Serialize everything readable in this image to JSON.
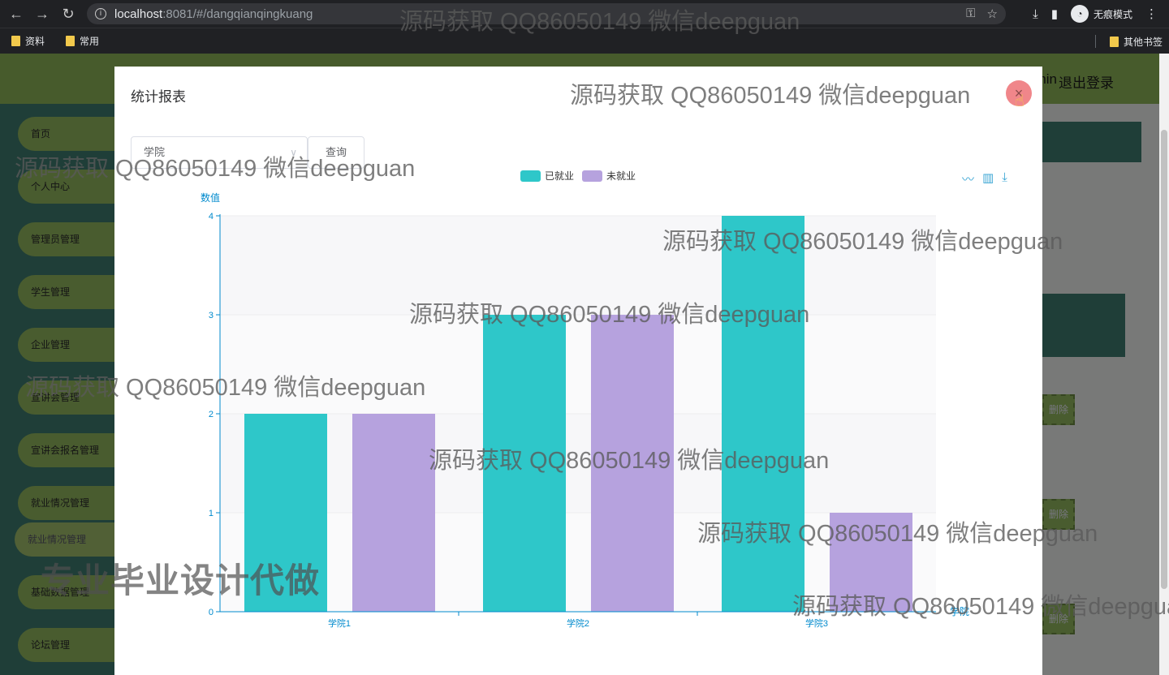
{
  "browser": {
    "url_host": "localhost",
    "url_path": ":8081/#/dangqianqingkuang",
    "incognito_label": "无痕模式",
    "bookmarks": [
      "资料",
      "常用"
    ],
    "other_bookmarks": "其他书签"
  },
  "app": {
    "header_user": "min",
    "logout": "退出登录",
    "menu": [
      "首页",
      "个人中心",
      "管理员管理",
      "学生管理",
      "企业管理",
      "宣讲会管理",
      "宣讲会报名管理",
      "就业情况管理",
      "就业情况管理",
      "基础数据管理",
      "论坛管理"
    ],
    "delete_label": "删除"
  },
  "dialog": {
    "title": "统计报表",
    "close_symbol": "×",
    "select_value": "学院",
    "query_label": "查询"
  },
  "chart_data": {
    "type": "bar",
    "categories": [
      "学院1",
      "学院2",
      "学院3"
    ],
    "series": [
      {
        "name": "已就业",
        "values": [
          2,
          3,
          4
        ],
        "color": "#2ec7c9"
      },
      {
        "name": "未就业",
        "values": [
          2,
          3,
          1
        ],
        "color": "#b6a2de"
      }
    ],
    "ylabel": "数值",
    "xlabel": "学院",
    "ylim": [
      0,
      4
    ],
    "yticks": [
      "0",
      "1",
      "2",
      "3",
      "4"
    ],
    "legend_position": "top-center",
    "axis_color": "#008acd"
  },
  "watermarks": {
    "text": "源码获取 QQ86050149 微信deepguan",
    "big_text": "专业毕业设计代做"
  }
}
